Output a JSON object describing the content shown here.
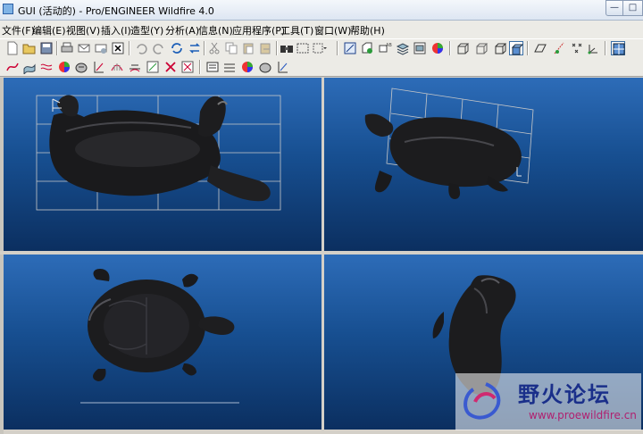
{
  "window": {
    "title": "GUI (活动的) - Pro/ENGINEER Wildfire 4.0",
    "minimize_glyph": "—",
    "maximize_glyph": "□"
  },
  "menu": {
    "items": [
      "文件(F)",
      "编辑(E)",
      "视图(V)",
      "插入(I)",
      "造型(Y)",
      "分析(A)",
      "信息(N)",
      "应用程序(P)",
      "工具(T)",
      "窗口(W)",
      "帮助(H)"
    ]
  },
  "toolbar1": {
    "icons": [
      "new-file-icon",
      "open-file-icon",
      "save-icon",
      "print-icon",
      "email-icon",
      "email-link-icon",
      "close-window-icon",
      "undo-icon",
      "redo-icon",
      "regenerate-icon",
      "cut-icon",
      "copy-icon",
      "paste-icon",
      "paste-special-icon",
      "find-icon",
      "select-box-icon",
      "repaint-icon",
      "spin-center-icon",
      "orient-icon",
      "saved-views-icon",
      "layers-icon",
      "appearance-icon",
      "shading-icon",
      "hidden-line-icon",
      "no-hidden-icon",
      "wireframe-icon",
      "shaded-icon",
      "datum-planes-icon",
      "datum-axes-icon",
      "datum-points-icon",
      "coordinate-systems-icon",
      "four-view-icon"
    ]
  },
  "toolbar2": {
    "icons": [
      "curve-icon",
      "surface-icon",
      "blend-icon",
      "analysis-icon",
      "shade-icon",
      "measure-icon",
      "curvature-icon",
      "section-icon",
      "draft-icon",
      "delete-analysis-icon",
      "reflection-icon",
      "dihedral-icon",
      "slope-icon",
      "highlight-icon",
      "light-icon"
    ]
  },
  "viewports": {
    "top_left": "front-view",
    "top_right": "isometric-view",
    "bottom_left": "top-view",
    "bottom_right": "side-view"
  },
  "colors": {
    "viewport_top": "#2d6cb8",
    "viewport_bottom": "#0b2f60",
    "model": "#1c1c1e",
    "grid": "#c8c8c8"
  },
  "watermark": {
    "brand": "野火论坛",
    "url": "www.proewildfire.cn"
  }
}
